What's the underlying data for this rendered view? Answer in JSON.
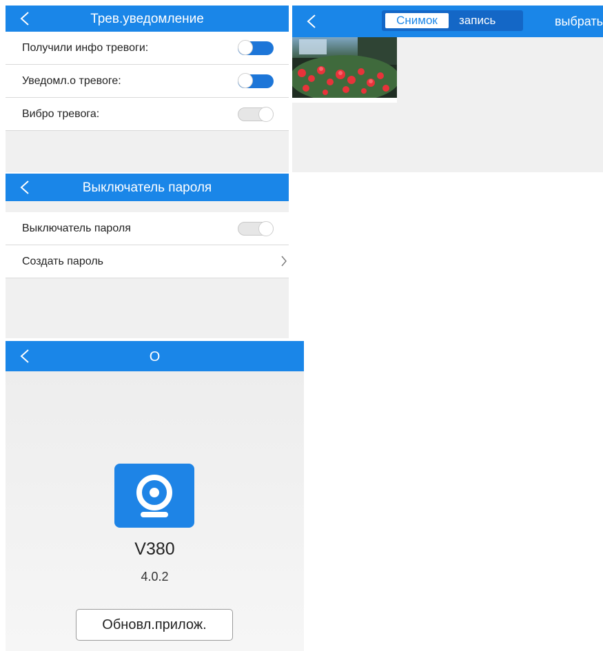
{
  "colors": {
    "accent": "#1a86e8",
    "toggle_on": "#1d76d8",
    "toggle_off": "#e6e6e6"
  },
  "alarm_panel": {
    "title": "Трев.уведомление",
    "rows": [
      {
        "label": "Получили инфо тревоги:",
        "enabled": true
      },
      {
        "label": "Уведомл.о тревоге:",
        "enabled": true
      },
      {
        "label": "Вибро тревога:",
        "enabled": false
      }
    ]
  },
  "media_panel": {
    "tabs": [
      {
        "label": "Снимок",
        "active": true
      },
      {
        "label": "запись",
        "active": false
      }
    ],
    "select_label": "выбрать"
  },
  "password_panel": {
    "title": "Выключатель пароля",
    "rows": [
      {
        "label": "Выключатель пароля",
        "control": "toggle",
        "enabled": false
      },
      {
        "label": "Создать пароль",
        "control": "chevron"
      }
    ]
  },
  "about_panel": {
    "title": "О",
    "app_name": "V380",
    "version": "4.0.2",
    "update_button": "Обновл.прилож.",
    "icon": "camera-icon"
  }
}
